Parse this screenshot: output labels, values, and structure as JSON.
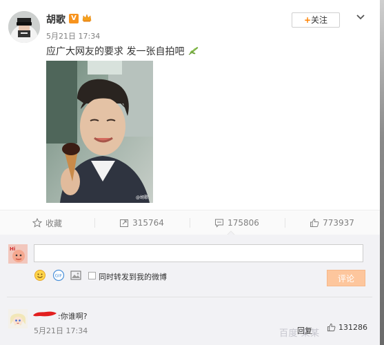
{
  "post": {
    "author": "胡歌",
    "verified_badge": "V",
    "time": "5月21日 17:34",
    "text": "应广大网友的要求 发一张自拍吧",
    "follow_label": "关注",
    "follow_plus": "+",
    "photo_watermark": "@胡歌"
  },
  "actions": {
    "favorite_label": "收藏",
    "repost_count": "315764",
    "comment_count": "175806",
    "like_count": "773937"
  },
  "composer": {
    "input_value": "",
    "repost_label": "同时转发到我的微博",
    "submit_label": "评论",
    "avatar_text": "Hi"
  },
  "comment": {
    "text": "你谁啊?",
    "time": "5月21日 17:34",
    "reply_label": "回复",
    "like_count": "131286"
  },
  "watermark": "百度·某某",
  "colors": {
    "accent_orange": "#ff8200",
    "badge_orange": "#f7931e",
    "submit_disabled": "#fdc69d",
    "muted_text": "#808080"
  },
  "icons": {
    "favorite": "star-icon",
    "repost": "repost-icon",
    "comment": "comment-icon",
    "like": "thumb-up-icon",
    "emoji": "emoji-icon",
    "gif": "gif-icon",
    "image": "image-icon",
    "menu": "chevron-down-icon"
  }
}
